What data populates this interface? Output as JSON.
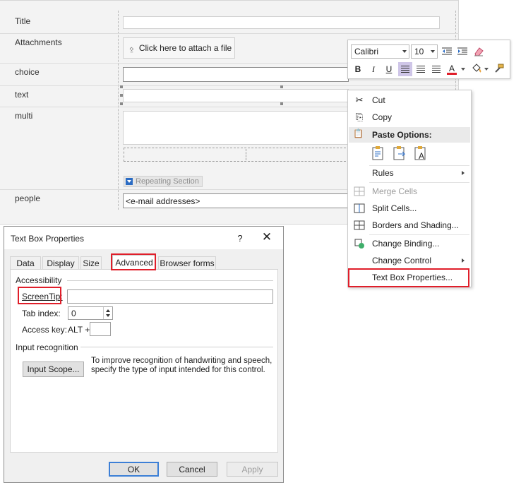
{
  "form": {
    "fields": [
      {
        "label": "Title"
      },
      {
        "label": "Attachments",
        "button": "Click here to attach a file"
      },
      {
        "label": "choice"
      },
      {
        "label": "text"
      },
      {
        "label": "multi",
        "repeating_section": "Repeating Section"
      },
      {
        "label": "people",
        "placeholder": "<e-mail addresses>"
      }
    ]
  },
  "mini_toolbar": {
    "font": "Calibri",
    "size": "10",
    "bold": "B",
    "italic": "I",
    "underline": "U",
    "font_color_letter": "A",
    "icons": [
      "decrease-indent-icon",
      "increase-indent-icon",
      "clear-formatting-icon",
      "align-left-icon",
      "align-center-icon",
      "align-right-icon",
      "font-color-icon",
      "shading-icon",
      "format-painter-icon"
    ],
    "font_color": "#e01e2a"
  },
  "context_menu": {
    "cut": "Cut",
    "copy": "Copy",
    "paste_options": "Paste Options:",
    "rules": "Rules",
    "merge_cells": "Merge Cells",
    "split_cells": "Split Cells...",
    "borders_shading": "Borders and Shading...",
    "change_binding": "Change Binding...",
    "change_control": "Change Control",
    "text_box_properties": "Text Box Properties..."
  },
  "dialog": {
    "title": "Text Box Properties",
    "help": "?",
    "close": "✕",
    "tabs": [
      "Data",
      "Display",
      "Size",
      "Advanced",
      "Browser forms"
    ],
    "active_tab": "Advanced",
    "accessibility": {
      "heading": "Accessibility",
      "screentip_label": "ScreenTip:",
      "screentip_value": "",
      "tab_index_label": "Tab index:",
      "tab_index_value": "0",
      "access_key_label": "Access key:",
      "access_key_prefix": "ALT +",
      "access_key_value": ""
    },
    "input_recognition": {
      "heading": "Input recognition",
      "button": "Input Scope...",
      "hint": "To improve recognition of handwriting and speech, specify the type of input intended for this control."
    },
    "buttons": {
      "ok": "OK",
      "cancel": "Cancel",
      "apply": "Apply"
    }
  },
  "highlight_color": "#e01e2a"
}
